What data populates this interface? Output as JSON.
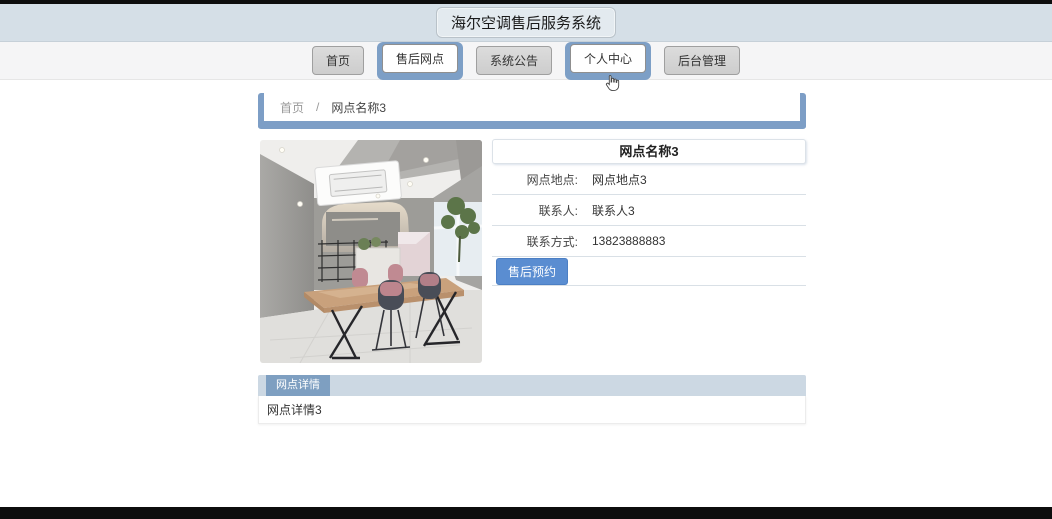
{
  "app": {
    "title": "海尔空调售后服务系统"
  },
  "nav": {
    "items": [
      {
        "label": "首页",
        "active": false
      },
      {
        "label": "售后网点",
        "active": true
      },
      {
        "label": "系统公告",
        "active": false
      },
      {
        "label": "个人中心",
        "active": true
      },
      {
        "label": "后台管理",
        "active": false
      }
    ]
  },
  "breadcrumb": {
    "home": "首页",
    "separator": "/",
    "current": "网点名称3"
  },
  "detail": {
    "title": "网点名称3",
    "fields": [
      {
        "label": "网点地点:",
        "value": "网点地点3"
      },
      {
        "label": "联系人:",
        "value": "联系人3"
      },
      {
        "label": "联系方式:",
        "value": "13823888883"
      }
    ],
    "action_label": "售后预约"
  },
  "tabs": {
    "active_label": "网点详情",
    "content": "网点详情3"
  },
  "photo": {
    "description": "showroom-interior-photo"
  },
  "colors": {
    "accent_blue": "#7d9ec6",
    "button_blue": "#5a8dd1",
    "header_bg": "#d5dfe7",
    "nav_bg": "#f5f5f6",
    "tabbar_bg": "#ccd8e3",
    "black_bar": "#0d0d0d"
  }
}
